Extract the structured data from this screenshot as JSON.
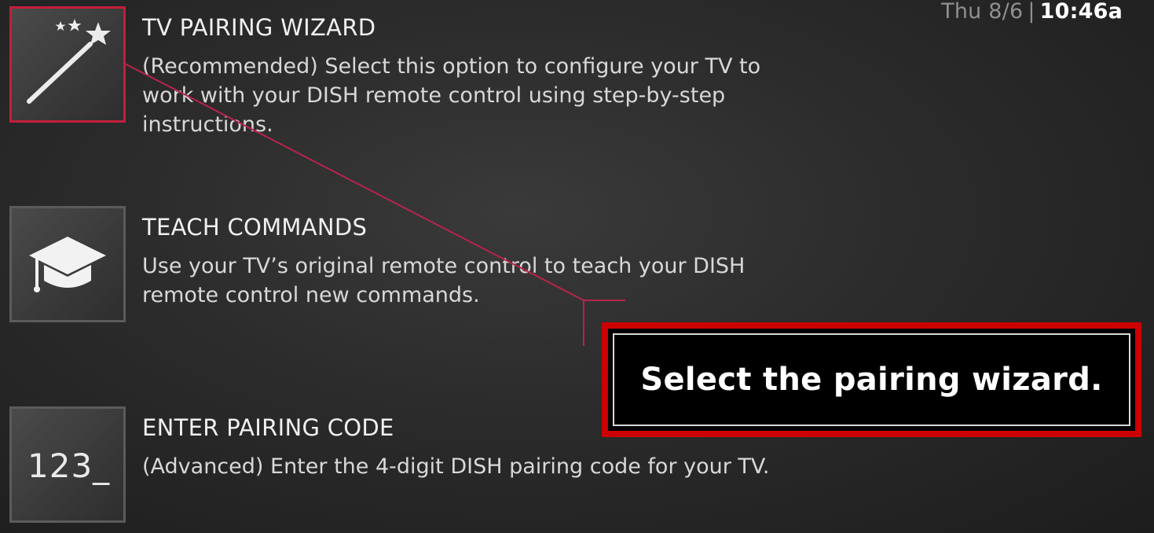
{
  "status_bar": {
    "date": "Thu 8/6",
    "separator": "|",
    "time": "10:46a"
  },
  "menu": {
    "items": [
      {
        "title": "TV PAIRING WIZARD",
        "description": "(Recommended) Select this option to configure your TV to work with your DISH remote control using step-by-step instructions.",
        "icon": "magic-wand-icon",
        "selected": true
      },
      {
        "title": "TEACH COMMANDS",
        "description": "Use your TV’s original remote control to teach your DISH remote control new commands.",
        "icon": "graduation-cap-icon",
        "selected": false
      },
      {
        "title": "ENTER PAIRING CODE",
        "description": "(Advanced) Enter the 4-digit DISH pairing code for your TV.",
        "icon": "pairing-code-icon",
        "icon_text": "123_",
        "selected": false
      }
    ]
  },
  "annotation": {
    "text": "Select the pairing wizard."
  },
  "colors": {
    "selection_border": "#c41e3a",
    "callout_border": "#cc0000",
    "background": "#2b2b2b",
    "tile_border": "#5b5b5b"
  }
}
